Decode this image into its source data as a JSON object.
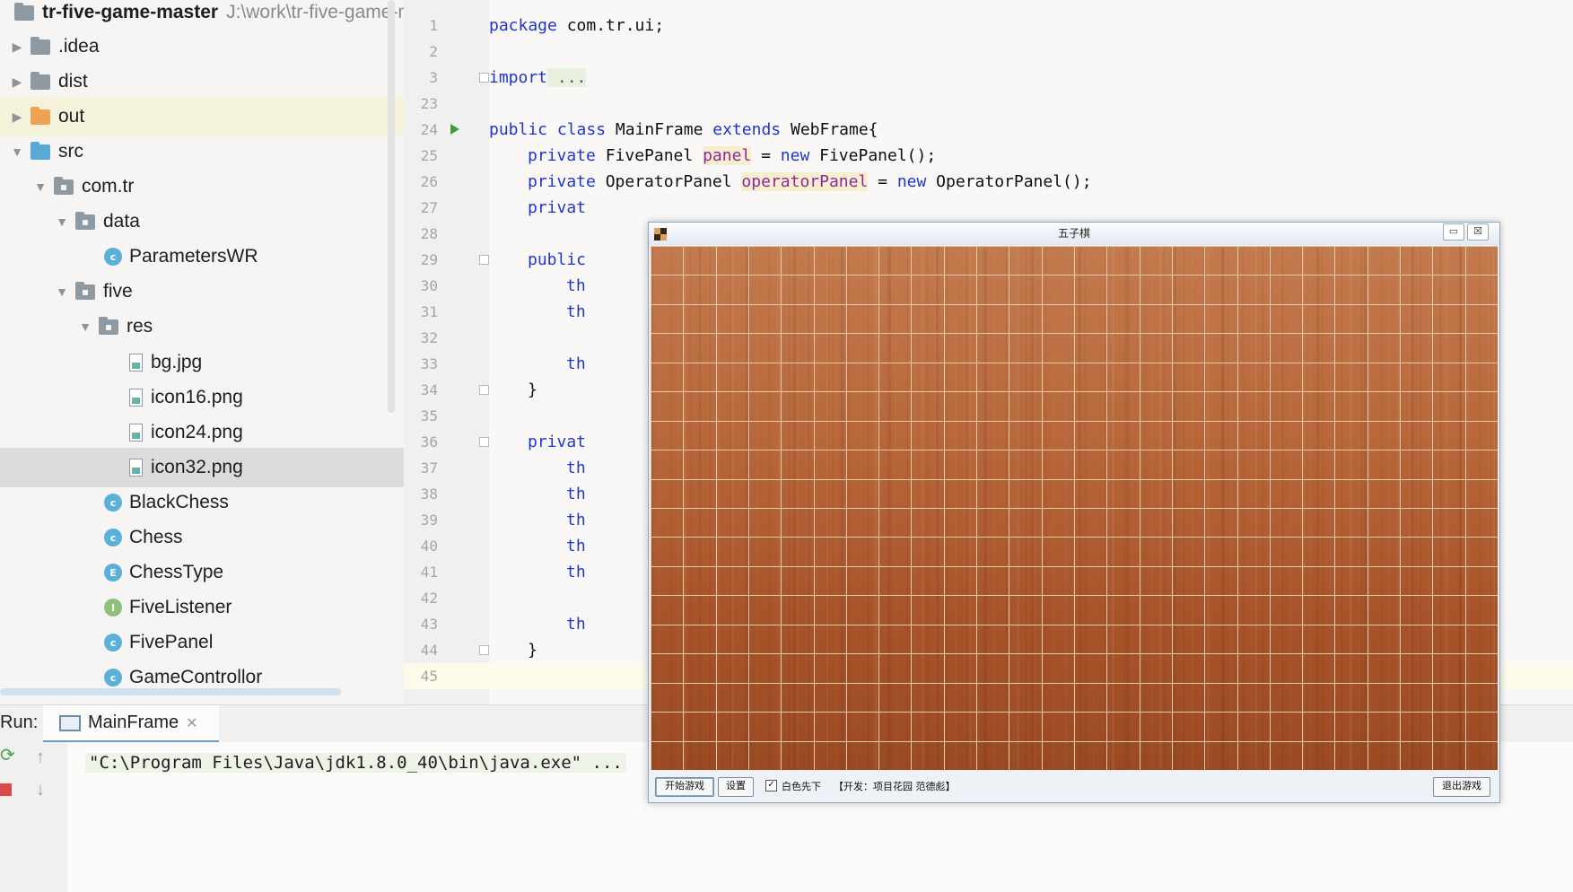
{
  "project": {
    "root_name": "tr-five-game-master",
    "root_path": "J:\\work\\tr-five-game-ma",
    "items": [
      {
        "label": ".idea"
      },
      {
        "label": "dist"
      },
      {
        "label": "out"
      },
      {
        "label": "src"
      },
      {
        "label": "com.tr"
      },
      {
        "label": "data"
      },
      {
        "label": "ParametersWR",
        "kind": "C"
      },
      {
        "label": "five"
      },
      {
        "label": "res"
      },
      {
        "label": "bg.jpg"
      },
      {
        "label": "icon16.png"
      },
      {
        "label": "icon24.png"
      },
      {
        "label": "icon32.png"
      },
      {
        "label": "BlackChess",
        "kind": "C"
      },
      {
        "label": "Chess",
        "kind": "C"
      },
      {
        "label": "ChessType",
        "kind": "E"
      },
      {
        "label": "FiveListener",
        "kind": "I"
      },
      {
        "label": "FivePanel",
        "kind": "C"
      },
      {
        "label": "GameControllor",
        "kind": "C"
      }
    ]
  },
  "editor": {
    "lines": [
      {
        "n": "1",
        "code": "package com.tr.ui;"
      },
      {
        "n": "2",
        "code": ""
      },
      {
        "n": "3",
        "kw": "import",
        "rest": " ..."
      },
      {
        "n": "23",
        "code": ""
      },
      {
        "n": "24",
        "parts": [
          "public",
          " ",
          "class",
          " MainFrame ",
          "extends",
          " WebFrame{"
        ]
      },
      {
        "n": "25",
        "parts": [
          "private",
          " FivePanel ",
          "panel",
          " = ",
          "new",
          " FivePanel();"
        ]
      },
      {
        "n": "26",
        "parts": [
          "private",
          " OperatorPanel ",
          "operatorPanel",
          " = ",
          "new",
          " OperatorPanel();"
        ]
      },
      {
        "n": "27",
        "kw": "privat"
      },
      {
        "n": "28",
        "code": ""
      },
      {
        "n": "29",
        "kw": "public"
      },
      {
        "n": "30",
        "kw": "th"
      },
      {
        "n": "31",
        "kw": "th"
      },
      {
        "n": "32",
        "code": ""
      },
      {
        "n": "33",
        "kw": "th"
      },
      {
        "n": "34",
        "code": "}"
      },
      {
        "n": "35",
        "code": ""
      },
      {
        "n": "36",
        "kw": "privat"
      },
      {
        "n": "37",
        "kw": "th"
      },
      {
        "n": "38",
        "kw": "th"
      },
      {
        "n": "39",
        "kw": "th"
      },
      {
        "n": "40",
        "kw": "th"
      },
      {
        "n": "41",
        "kw": "th"
      },
      {
        "n": "42",
        "code": ""
      },
      {
        "n": "43",
        "kw": "th"
      },
      {
        "n": "44",
        "code": "}"
      },
      {
        "n": "45",
        "code": ""
      }
    ]
  },
  "run": {
    "label": "Run:",
    "tab": "MainFrame",
    "console_line": "\"C:\\Program Files\\Java\\jdk1.8.0_40\\bin\\java.exe\" ..."
  },
  "game_window": {
    "title": "五子棋",
    "minimize": "▭",
    "close": "☒",
    "start_button": "开始游戏",
    "settings_button": "设置",
    "checkbox_label": "白色先下",
    "checkbox_checked": true,
    "developer_text": "【开发：项目花园   范德彪】",
    "exit_button": "退出游戏",
    "board_color": "#b0602f",
    "grid_color": "#e8c9b0"
  }
}
